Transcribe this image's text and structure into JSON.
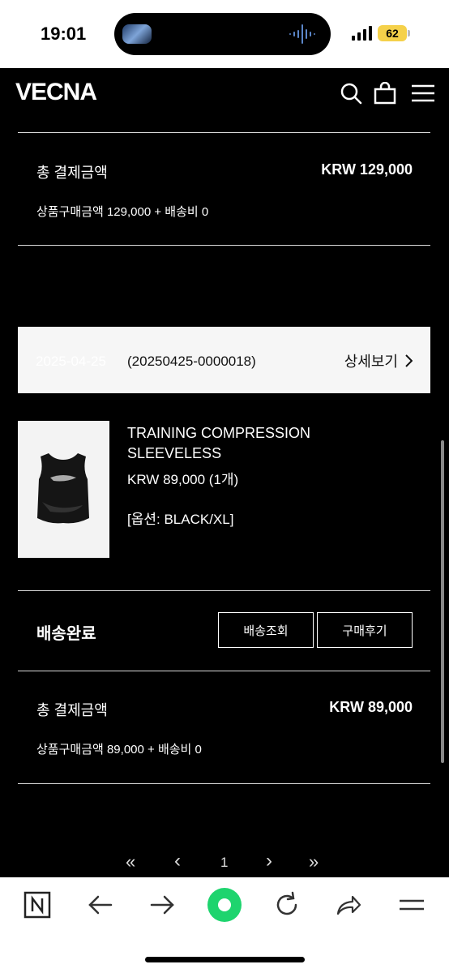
{
  "status_bar": {
    "time": "19:01",
    "battery": "62"
  },
  "header": {
    "logo": "VECNA"
  },
  "summary1": {
    "label": "총 결제금액",
    "amount": "KRW 129,000",
    "detail": "상품구매금액 129,000 + 배송비 0"
  },
  "order": {
    "date": "2025-04-25",
    "number": "(20250425-0000018)",
    "detail_link": "상세보기"
  },
  "product": {
    "name": "TRAINING COMPRESSION SLEEVELESS",
    "price": "KRW 89,000 (1개)",
    "option": "[옵션: BLACK/XL]"
  },
  "delivery": {
    "status": "배송완료",
    "track_button": "배송조회",
    "review_button": "구매후기"
  },
  "summary2": {
    "label": "총 결제금액",
    "amount": "KRW 89,000",
    "detail": "상품구매금액 89,000 + 배송비 0"
  },
  "pagination": {
    "first": "«",
    "prev": "‹",
    "current": "1",
    "next": "›",
    "last": "»"
  },
  "icons": [
    "search-icon",
    "shopping-bag-icon",
    "menu-icon",
    "chevron-right-icon",
    "n-logo-icon",
    "back-arrow-icon",
    "forward-arrow-icon",
    "green-circle-icon",
    "reload-icon",
    "share-icon",
    "hamburger-icon"
  ],
  "colors": {
    "background": "#000000",
    "accent": "#1ed46e"
  }
}
